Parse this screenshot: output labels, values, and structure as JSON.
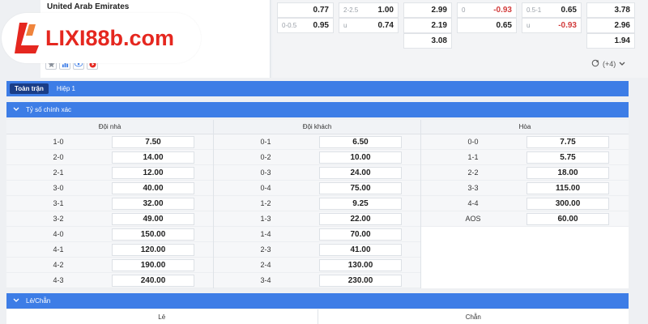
{
  "match": {
    "team": "United Arab Emirates",
    "more_markets": "(+4)"
  },
  "odds": {
    "r1": [
      "0.77",
      "2-2.5",
      "1.00",
      "2.99",
      "0",
      "-0.93",
      "0.5-1",
      "0.65",
      "3.78"
    ],
    "r2": [
      "0-0.5",
      "0.95",
      "u",
      "0.74",
      "2.19",
      "0.65",
      "u",
      "-0.93",
      "2.96"
    ],
    "r3": [
      "3.08",
      "1.94"
    ]
  },
  "logo": {
    "text": "LIXI88b.com"
  },
  "tabs": [
    {
      "label": "Toàn trận"
    },
    {
      "label": "Hiệp 1"
    }
  ],
  "sections": {
    "correct_score": "Tỷ số chính xác",
    "odd_even": "Lẻ/Chẵn"
  },
  "grid": {
    "home": {
      "header": "Đội nhà",
      "rows": [
        [
          "1-0",
          "7.50"
        ],
        [
          "2-0",
          "14.00"
        ],
        [
          "2-1",
          "12.00"
        ],
        [
          "3-0",
          "40.00"
        ],
        [
          "3-1",
          "32.00"
        ],
        [
          "3-2",
          "49.00"
        ],
        [
          "4-0",
          "150.00"
        ],
        [
          "4-1",
          "120.00"
        ],
        [
          "4-2",
          "190.00"
        ],
        [
          "4-3",
          "240.00"
        ]
      ]
    },
    "away": {
      "header": "Đội khách",
      "rows": [
        [
          "0-1",
          "6.50"
        ],
        [
          "0-2",
          "10.00"
        ],
        [
          "0-3",
          "24.00"
        ],
        [
          "0-4",
          "75.00"
        ],
        [
          "1-2",
          "9.25"
        ],
        [
          "1-3",
          "22.00"
        ],
        [
          "1-4",
          "70.00"
        ],
        [
          "2-3",
          "41.00"
        ],
        [
          "2-4",
          "130.00"
        ],
        [
          "3-4",
          "230.00"
        ]
      ]
    },
    "draw": {
      "header": "Hòa",
      "rows": [
        [
          "0-0",
          "7.75"
        ],
        [
          "1-1",
          "5.75"
        ],
        [
          "2-2",
          "18.00"
        ],
        [
          "3-3",
          "115.00"
        ],
        [
          "4-4",
          "300.00"
        ],
        [
          "AOS",
          "60.00"
        ]
      ]
    }
  },
  "bottom": {
    "odd": "Lẻ",
    "even": "Chẵn"
  },
  "colors": {
    "accent": "#3d7de6",
    "active_tab": "#1a3d86",
    "brand": "#e5271f",
    "negative": "#d23c3c"
  }
}
